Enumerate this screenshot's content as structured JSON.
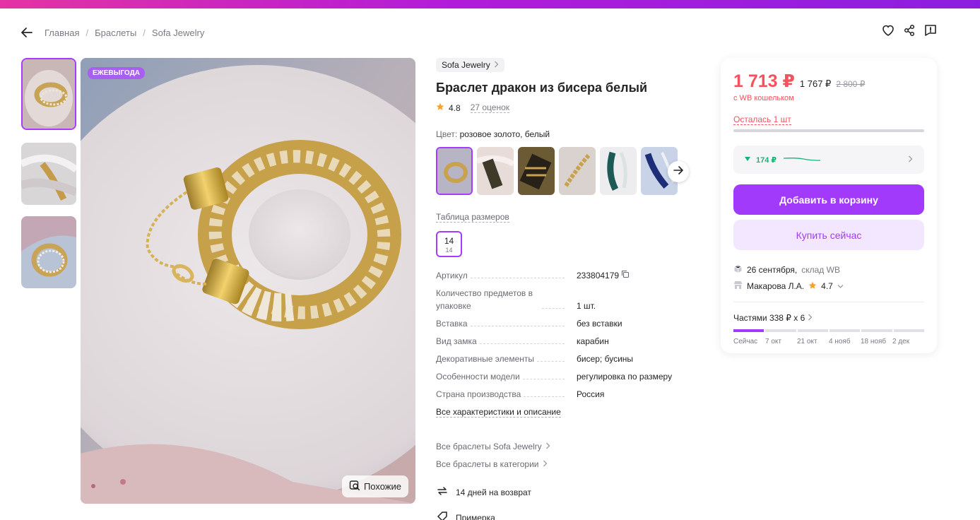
{
  "breadcrumb": {
    "items": [
      "Главная",
      "Браслеты",
      "Sofa Jewelry"
    ],
    "separator": "/"
  },
  "gallery": {
    "badge": "ЕЖЕВЫГОДА",
    "similar_label": "Похожие"
  },
  "product": {
    "brand": "Sofa Jewelry",
    "title": "Браслет дракон из бисера белый",
    "rating": "4.8",
    "reviews": "27 оценок",
    "color_label": "Цвет:",
    "color_value": "розовое золото, белый",
    "size_table_label": "Таблица размеров",
    "size": {
      "main": "14",
      "sub": "14"
    }
  },
  "specs": [
    {
      "key": "Артикул",
      "value": "233804179"
    },
    {
      "key": "Количество предметов в упаковке",
      "value": "1 шт."
    },
    {
      "key": "Вставка",
      "value": "без вставки"
    },
    {
      "key": "Вид замка",
      "value": "карабин"
    },
    {
      "key": "Декоративные элементы",
      "value": "бисер; бусины"
    },
    {
      "key": "Особенности модели",
      "value": "регулировка по размеру"
    },
    {
      "key": "Страна производства",
      "value": "Россия"
    }
  ],
  "links": {
    "all_specs": "Все характеристики и описание",
    "brand_link": "Все браслеты Sofa Jewelry",
    "category_link": "Все браслеты в категории"
  },
  "features": {
    "return": "14 дней на возврат",
    "fitting": "Примерка"
  },
  "buy": {
    "price": "1 713 ₽",
    "price2": "1 767 ₽",
    "price_old": "2 800 ₽",
    "wallet": "с WB кошельком",
    "left": "Осталась 1 шт",
    "history_delta": "174 ₽",
    "cart_button": "Добавить в корзину",
    "buy_button": "Купить сейчас",
    "delivery_date": "26 сентября,",
    "delivery_place": "склад WB",
    "seller_name": "Макарова Л.А.",
    "seller_rating": "4.7",
    "parts_label": "Частями 338 ₽ x 6",
    "parts_dates": [
      "Сейчас",
      "7 окт",
      "21 окт",
      "4 нояб",
      "18 нояб",
      "2 дек"
    ]
  },
  "colors": {
    "accent": "#a13afb",
    "price": "#f5515f",
    "green": "#14b576"
  }
}
